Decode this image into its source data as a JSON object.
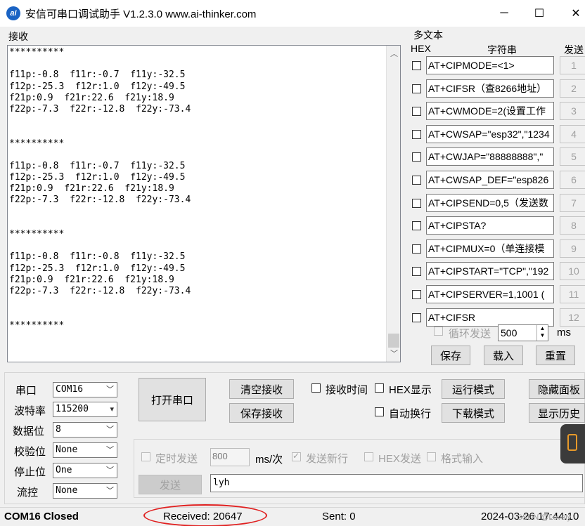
{
  "window": {
    "title": "安信可串口调试助手 V1.2.3.0    www.ai-thinker.com",
    "icon_text": "ai",
    "minimize_glyph": "─",
    "maximize_glyph": "☐",
    "close_glyph": "✕"
  },
  "receive": {
    "group_label": "接收",
    "lines": [
      "**********",
      "",
      "f11p:-0.8  f11r:-0.7  f11y:-32.5",
      "f12p:-25.3  f12r:1.0  f12y:-49.5",
      "f21p:0.9  f21r:22.6  f21y:18.9",
      "f22p:-7.3  f22r:-12.8  f22y:-73.4",
      "",
      "",
      "**********",
      "",
      "f11p:-0.8  f11r:-0.7  f11y:-32.5",
      "f12p:-25.3  f12r:1.0  f12y:-49.5",
      "f21p:0.9  f21r:22.6  f21y:18.9",
      "f22p:-7.3  f22r:-12.8  f22y:-73.4",
      "",
      "",
      "**********",
      "",
      "f11p:-0.8  f11r:-0.8  f11y:-32.5",
      "f12p:-25.3  f12r:1.0  f12y:-49.5",
      "f21p:0.9  f21r:22.6  f21y:18.9",
      "f22p:-7.3  f22r:-12.8  f22y:-73.4",
      "",
      "",
      "**********"
    ]
  },
  "multi": {
    "group_label": "多文本",
    "hex_header": "HEX",
    "string_header": "字符串",
    "send_header": "发送",
    "rows": [
      {
        "text": "AT+CIPMODE=<1>",
        "btn": "1"
      },
      {
        "text": "AT+CIFSR（查8266地址）",
        "btn": "2"
      },
      {
        "text": "AT+CWMODE=2(设置工作",
        "btn": "3"
      },
      {
        "text": "AT+CWSAP=\"esp32\",\"1234",
        "btn": "4"
      },
      {
        "text": "AT+CWJAP=\"88888888\",\"",
        "btn": "5"
      },
      {
        "text": "AT+CWSAP_DEF=\"esp826",
        "btn": "6"
      },
      {
        "text": "AT+CIPSEND=0,5（发送数",
        "btn": "7"
      },
      {
        "text": "AT+CIPSTA?",
        "btn": "8"
      },
      {
        "text": "AT+CIPMUX=0（单连接模",
        "btn": "9"
      },
      {
        "text": "AT+CIPSTART=\"TCP\",\"192",
        "btn": "10"
      },
      {
        "text": "AT+CIPSERVER=1,1001 (",
        "btn": "11"
      },
      {
        "text": "AT+CIFSR",
        "btn": "12"
      }
    ],
    "loop_label": "循环发送",
    "loop_value": "500",
    "loop_unit": "ms",
    "save": "保存",
    "load": "载入",
    "reset": "重置"
  },
  "serial": {
    "port_label": "串口",
    "port_value": "COM16",
    "baud_label": "波特率",
    "baud_value": "115200",
    "databits_label": "数据位",
    "databits_value": "8",
    "parity_label": "校验位",
    "parity_value": "None",
    "stopbits_label": "停止位",
    "stopbits_value": "One",
    "flow_label": "流控",
    "flow_value": "None"
  },
  "controls": {
    "open_port": "打开串口",
    "clear_recv": "清空接收",
    "save_recv": "保存接收",
    "recv_time": "接收时间",
    "hex_display": "HEX显示",
    "run_mode": "运行模式",
    "hide_panel": "隐藏面板",
    "auto_wrap": "自动换行",
    "download_mode": "下载模式",
    "show_history": "显示历史"
  },
  "send": {
    "timed_send": "定时发送",
    "interval_value": "800",
    "interval_unit": "ms/次",
    "send_newline": "发送新行",
    "hex_send": "HEX发送",
    "format_input": "格式输入",
    "send_button": "发送",
    "send_text": "lyh"
  },
  "status": {
    "port_state": "COM16 Closed",
    "received": "Received: 20647",
    "sent": "Sent: 0",
    "datetime": "2024-03-26 17:44:10",
    "watermark": "CSDN @Lovely"
  }
}
